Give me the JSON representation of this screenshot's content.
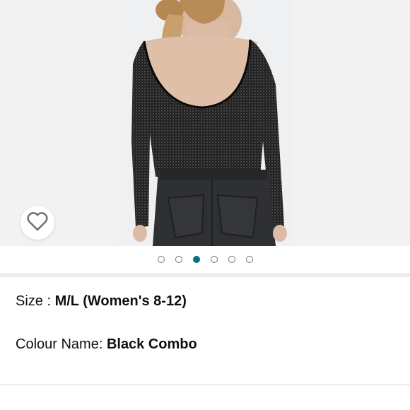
{
  "carousel": {
    "dot_count": 6,
    "active_index": 2
  },
  "colors": {
    "accent_teal": "#007185",
    "text": "#0f1111",
    "band": "#eaeded"
  },
  "icons": {
    "wishlist": "heart-outline-icon"
  },
  "details": {
    "size_label": "Size : ",
    "size_value": "M/L (Women's 8-12)",
    "colour_label": "Colour Name: ",
    "colour_value": "Black Combo"
  }
}
